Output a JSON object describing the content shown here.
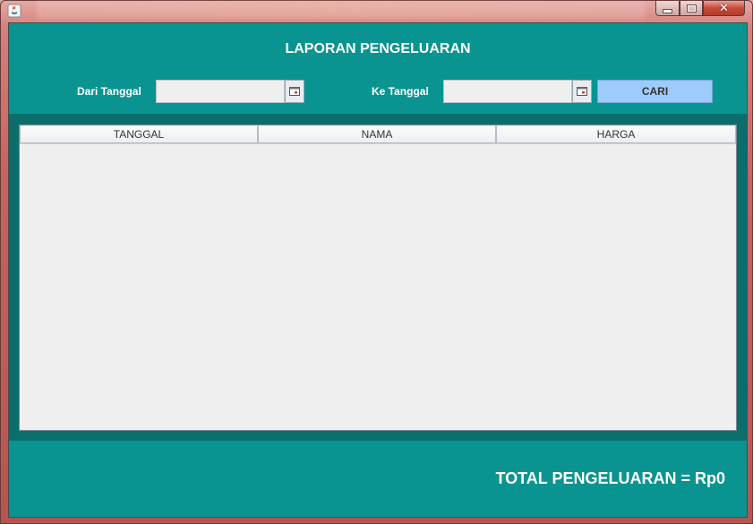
{
  "window": {
    "title": "",
    "controls": {
      "minimize_icon": "minimize-icon",
      "maximize_icon": "maximize-icon",
      "close_icon": "close-icon"
    }
  },
  "header": {
    "title": "LAPORAN PENGELUARAN"
  },
  "filters": {
    "from_label": "Dari Tanggal",
    "from_value": "",
    "to_label": "Ke Tanggal",
    "to_value": "",
    "search_label": "CARI"
  },
  "table": {
    "columns": [
      "TANGGAL",
      "NAMA",
      "HARGA"
    ],
    "rows": []
  },
  "footer": {
    "total_text": "TOTAL PENGELUARAN = Rp0"
  },
  "colors": {
    "panel_teal": "#0a9491",
    "dark_teal": "#0b6e6b",
    "search_button": "#9dcbfb",
    "table_bg": "#efefef"
  }
}
